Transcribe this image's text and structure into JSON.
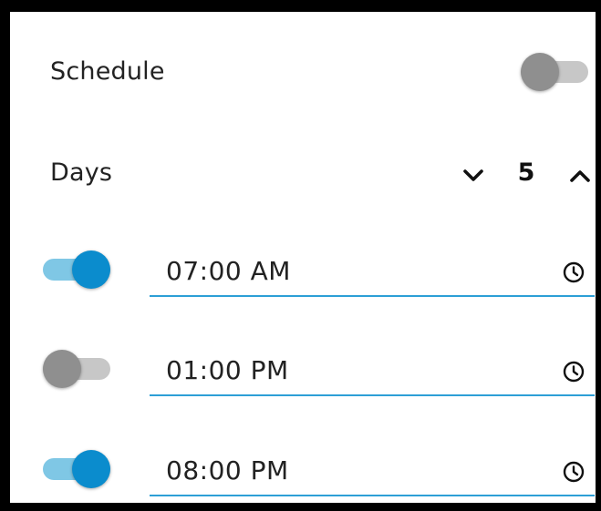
{
  "schedule": {
    "label": "Schedule",
    "enabled": false
  },
  "days": {
    "label": "Days",
    "value": "5",
    "decrement_icon": "chevron-down-icon",
    "increment_icon": "chevron-up-icon"
  },
  "times": [
    {
      "value": "07:00 AM",
      "enabled": true,
      "icon": "clock-icon"
    },
    {
      "value": "01:00 PM",
      "enabled": false,
      "icon": "clock-icon"
    },
    {
      "value": "08:00 PM",
      "enabled": true,
      "icon": "clock-icon"
    }
  ],
  "colors": {
    "accent": "#0b8ccd",
    "accent_track": "#7fc7e5",
    "off_knob": "#8f8f8f",
    "off_track": "#c7c7c7",
    "underline": "#2d9fd6",
    "frame": "#000000"
  }
}
